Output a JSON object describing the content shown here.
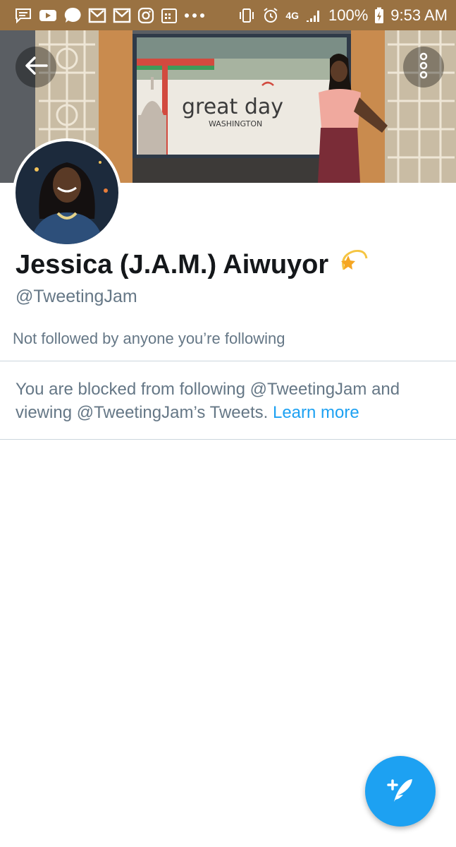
{
  "status_bar": {
    "battery_percent": "100%",
    "time": "9:53 AM",
    "network": "4G",
    "icons": [
      "message-icon",
      "youtube-icon",
      "signal-app-icon",
      "gmail-icon",
      "gmail-icon",
      "instagram-icon",
      "calendar-icon",
      "more-dots-icon",
      "vibrate-icon",
      "alarm-icon",
      "network-4g-icon",
      "signal-strength-icon",
      "battery-charging-icon"
    ]
  },
  "banner": {
    "show_name": "great day",
    "show_subtitle": "WASHINGTON"
  },
  "profile": {
    "display_name": "Jessica (J.A.M.) Aiwuyor",
    "name_emoji": "dizzy-star-icon",
    "handle": "@TweetingJam",
    "followed_by": "Not followed by anyone you’re following",
    "blocked_message": "You are blocked from following @TweetingJam and viewing @TweetingJam’s Tweets.",
    "learn_more_label": "Learn more"
  },
  "colors": {
    "status_bar": "#9a7242",
    "accent": "#1da1f2",
    "secondary_text": "#657786",
    "primary_text": "#14171a"
  }
}
